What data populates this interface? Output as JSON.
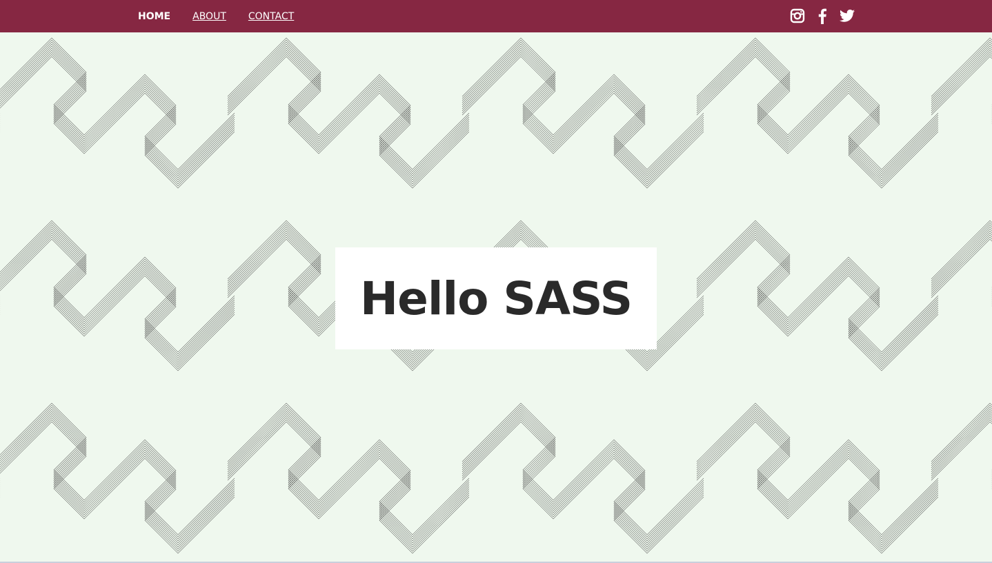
{
  "nav": {
    "items": [
      {
        "label": "HOME",
        "active": true
      },
      {
        "label": "ABOUT",
        "active": false
      },
      {
        "label": "CONTACT",
        "active": false
      }
    ]
  },
  "social": {
    "icons": [
      "instagram-icon",
      "facebook-icon",
      "twitter-icon"
    ]
  },
  "hero": {
    "title": "Hello SASS"
  },
  "colors": {
    "topbar": "#862742",
    "background": "#eff8ee",
    "pattern_stroke": "#3b3b3b",
    "title_text": "#2a2a2a"
  }
}
